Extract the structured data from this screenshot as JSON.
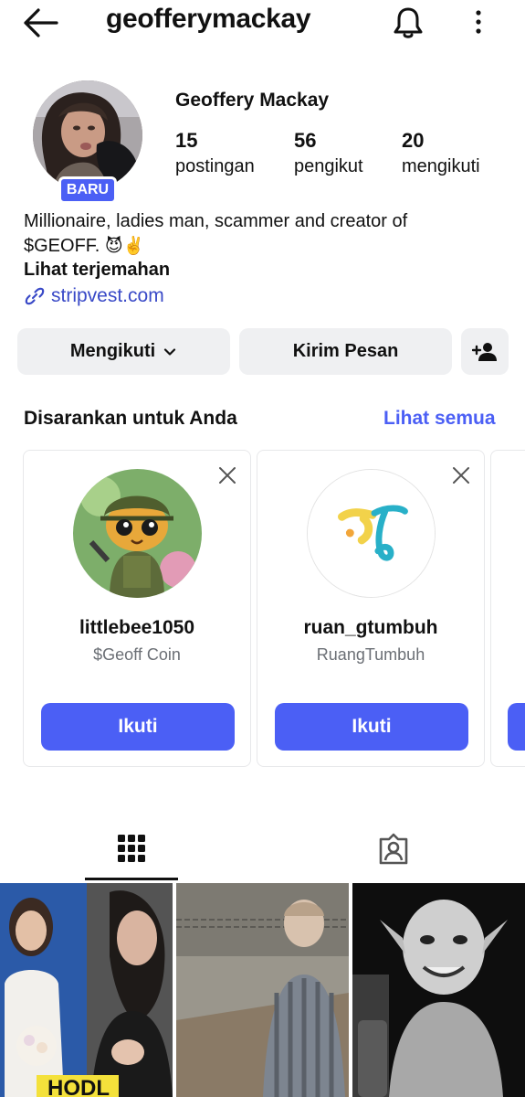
{
  "header": {
    "username": "geofferymackay",
    "icons": [
      "back-arrow-icon",
      "bell-icon",
      "more-vertical-icon"
    ]
  },
  "profile": {
    "name": "Geoffery Mackay",
    "badge": "BARU",
    "stats": [
      {
        "value": "15",
        "label": "postingan"
      },
      {
        "value": "56",
        "label": "pengikut"
      },
      {
        "value": "20",
        "label": "mengikuti"
      }
    ],
    "bio_line1": "Millionaire, ladies man, scammer and creator of",
    "bio_line2": "$GEOFF.",
    "bio_emojis": "😈✌️",
    "translate": "Lihat terjemahan",
    "link": "stripvest.com"
  },
  "actions": {
    "following": "Mengikuti",
    "message": "Kirim Pesan"
  },
  "suggested": {
    "title": "Disarankan untuk Anda",
    "see_all": "Lihat semua",
    "cards": [
      {
        "username": "littlebee1050",
        "subtitle": "$Geoff Coin",
        "button": "Ikuti"
      },
      {
        "username": "ruan_gtumbuh",
        "subtitle": "RuangTumbuh",
        "button": "Ikuti"
      }
    ]
  },
  "tabs": [
    "grid-icon",
    "tagged-icon"
  ],
  "colors": {
    "accent": "#4b5ff5",
    "link": "#3949c7",
    "button_gray": "#eff0f2"
  }
}
